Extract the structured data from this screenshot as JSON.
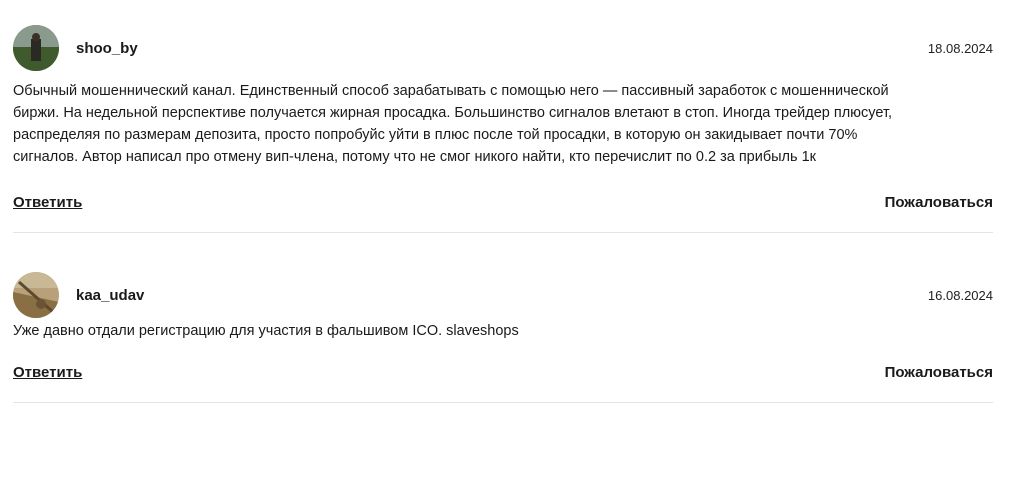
{
  "comments": [
    {
      "username": "shoo_by",
      "date": "18.08.2024",
      "text_lines": [
        "Обычный мошеннический канал. Единственный способ зарабатывать с помощью него — пассивный заработок с мошеннической",
        "биржи. На недельной перспективе получается жирная просадка. Большинство сигналов влетают в стоп. Иногда трейдер плюсует,",
        "распределяя по размерам депозита, просто попробуйс уйти в плюс после той просадки, в которую он закидывает почти 70%",
        "сигналов. Автор написал про отмену вип-члена, потому что не смог никого найти, кто перечислит по 0.2 за прибыль 1к"
      ],
      "reply_label": "Ответить",
      "report_label": "Пожаловаться"
    },
    {
      "username": "kaa_udav",
      "date": "16.08.2024",
      "text_lines": [
        "Уже давно отдали регистрацию для участия в фальшивом ICO. slaveshops"
      ],
      "reply_label": "Ответить",
      "report_label": "Пожаловаться"
    }
  ]
}
